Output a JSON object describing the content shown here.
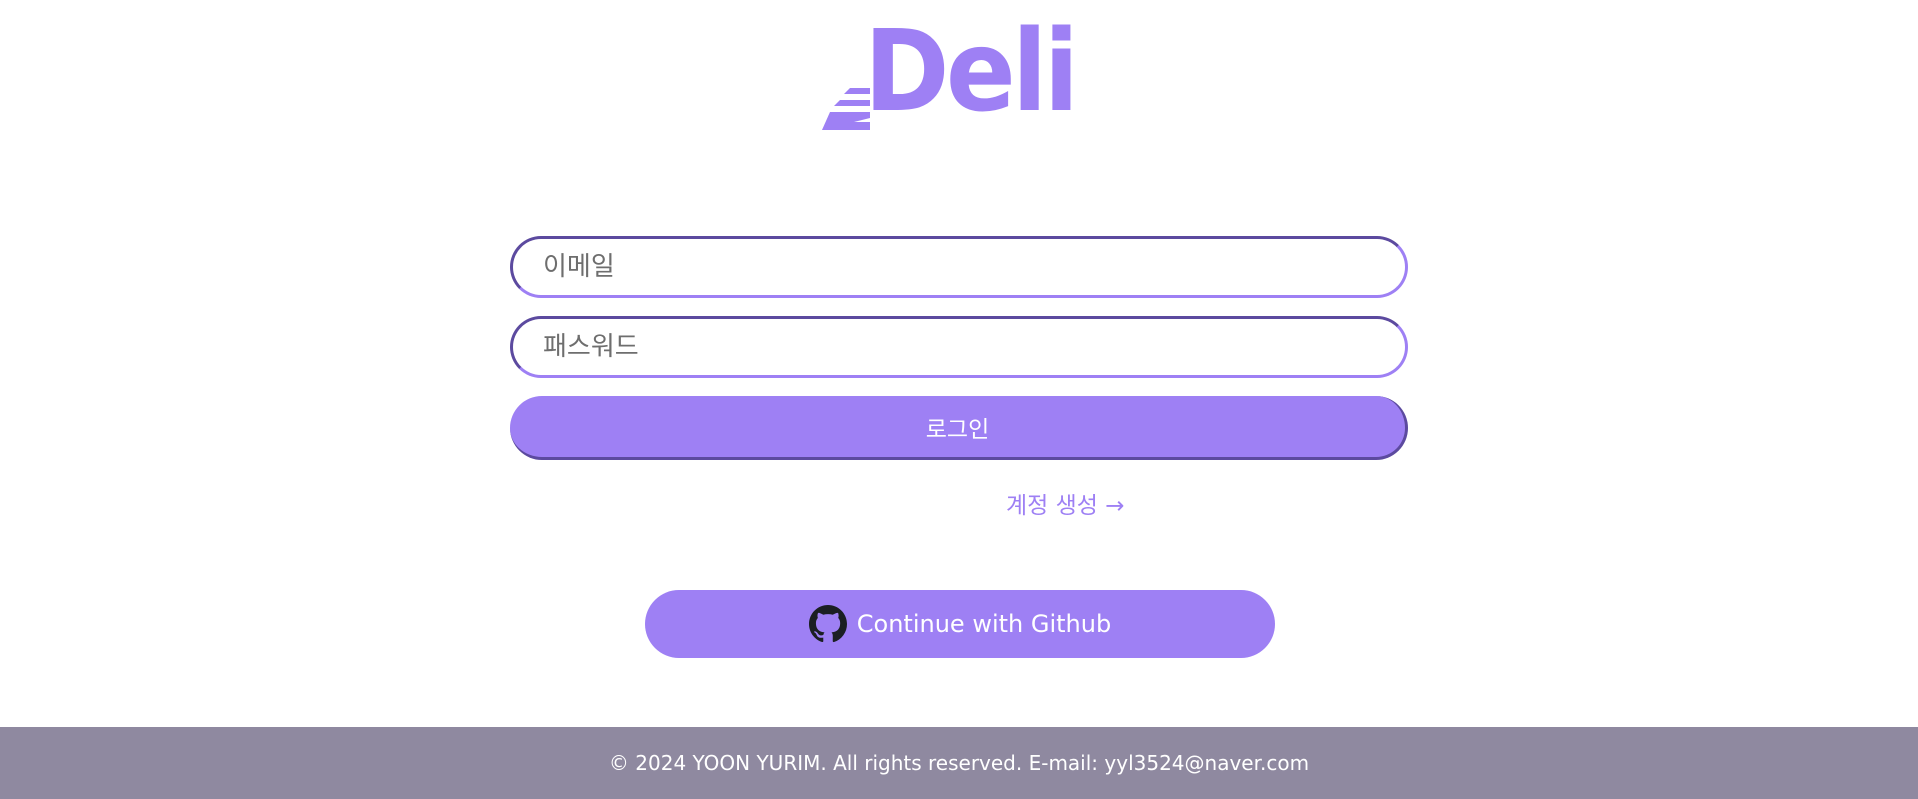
{
  "logo": {
    "text": "Deli",
    "color": "#9e80f4"
  },
  "form": {
    "email_placeholder": "이메일",
    "email_value": "",
    "password_placeholder": "패스워드",
    "password_value": "",
    "login_label": "로그인"
  },
  "signup": {
    "label": "계정 생성 →"
  },
  "github": {
    "icon": "github-icon",
    "label": "Continue with Github"
  },
  "footer": {
    "text": "© 2024 YOON YURIM. All rights reserved. E-mail: yyl3524@naver.com"
  },
  "colors": {
    "accent": "#9e80f4",
    "accent_dark": "#5c4a9f",
    "footer_bg": "#8f89a0"
  }
}
